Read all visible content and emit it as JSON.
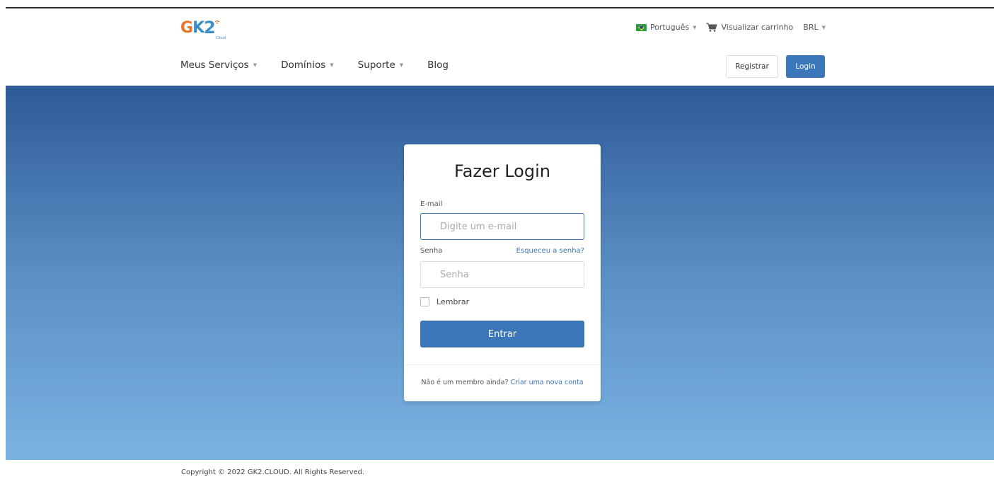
{
  "brand": {
    "logo_g": "G",
    "logo_k": "K",
    "logo_two": "2",
    "logo_sub": "Cloud",
    "accent_orange": "#e9742b",
    "accent_blue": "#3b8fc6"
  },
  "topbar": {
    "language": "Português",
    "cart": "Visualizar carrinho",
    "currency": "BRL"
  },
  "nav": {
    "items": [
      {
        "label": "Meus Serviços",
        "dropdown": true
      },
      {
        "label": "Domínios",
        "dropdown": true
      },
      {
        "label": "Suporte",
        "dropdown": true
      },
      {
        "label": "Blog",
        "dropdown": false
      }
    ]
  },
  "header_buttons": {
    "register": "Registrar",
    "login": "Login"
  },
  "login_card": {
    "title": "Fazer Login",
    "email_label": "E-mail",
    "email_placeholder": "Digite um e-mail",
    "password_label": "Senha",
    "forgot_link": "Esqueceu a senha?",
    "password_placeholder": "Senha",
    "remember_label": "Lembrar",
    "submit": "Entrar",
    "footer_text": "Não é um membro ainda?",
    "footer_link": "Criar uma nova conta"
  },
  "footer": {
    "copyright": "Copyright © 2022 GK2.CLOUD. All Rights Reserved."
  },
  "colors": {
    "primary": "#3b76b8",
    "hero_top": "#2e5a98",
    "hero_bottom": "#7ab3e2"
  }
}
